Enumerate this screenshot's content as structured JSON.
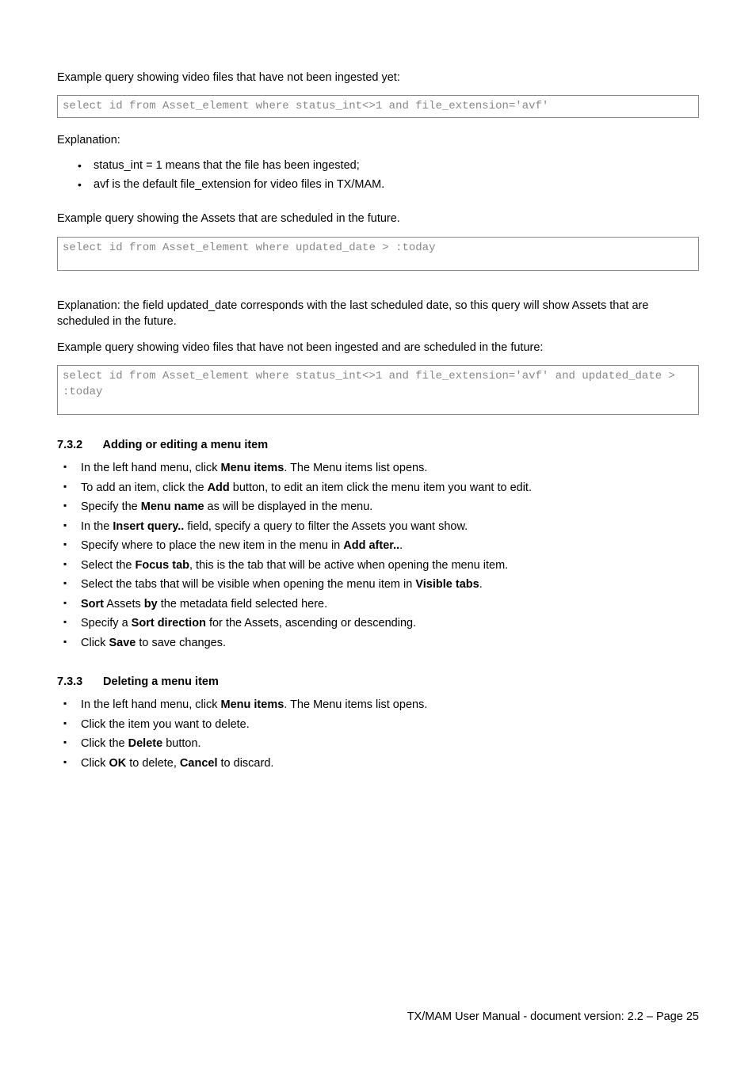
{
  "p1": "Example query showing video files that have not been ingested yet:",
  "code1": "select id from Asset_element where status_int<>1 and file_extension='avf'",
  "p2": "Explanation:",
  "circle_list": [
    "status_int = 1 means that the file has been ingested;",
    "avf is the default file_extension for video files in TX/MAM."
  ],
  "p3": "Example query showing the Assets that are scheduled in the future.",
  "code2": "select id from Asset_element where updated_date > :today",
  "p4": "Explanation: the field updated_date corresponds with the last scheduled date, so this query will show Assets that are scheduled in the future.",
  "p5": "Example query showing video files that have not been ingested and are scheduled in the future:",
  "code3": "select id from Asset_element where status_int<>1 and file_extension='avf' and updated_date > :today",
  "sec1": {
    "num": "7.3.2",
    "title": "Adding or editing a menu item"
  },
  "sec1_items": [
    [
      [
        "In the left hand menu, click "
      ],
      [
        "Menu items",
        "b"
      ],
      [
        ". The Menu items list opens."
      ]
    ],
    [
      [
        "To add an item, click the "
      ],
      [
        "Add",
        "b"
      ],
      [
        " button, to edit an item click the menu item you want to edit."
      ]
    ],
    [
      [
        "Specify the "
      ],
      [
        "Menu name",
        "b"
      ],
      [
        " as will be displayed in the menu."
      ]
    ],
    [
      [
        "In the "
      ],
      [
        "Insert query..",
        "b"
      ],
      [
        " field, specify a query to filter the Assets you want show."
      ]
    ],
    [
      [
        "Specify where to place the new item in the menu in "
      ],
      [
        "Add after..",
        "b"
      ],
      [
        "."
      ]
    ],
    [
      [
        "Select the "
      ],
      [
        "Focus tab",
        "b"
      ],
      [
        ", this is the tab that will be active when opening the menu item."
      ]
    ],
    [
      [
        "Select the tabs that will be visible when opening the menu item in "
      ],
      [
        "Visible tabs",
        "b"
      ],
      [
        "."
      ]
    ],
    [
      [
        "Sort",
        "b"
      ],
      [
        " Assets "
      ],
      [
        "by",
        "b"
      ],
      [
        " the metadata field selected here."
      ]
    ],
    [
      [
        "Specify a "
      ],
      [
        "Sort direction",
        "b"
      ],
      [
        " for the Assets, ascending or descending."
      ]
    ],
    [
      [
        "Click "
      ],
      [
        "Save",
        "b"
      ],
      [
        " to save changes."
      ]
    ]
  ],
  "sec2": {
    "num": "7.3.3",
    "title": "Deleting a menu item"
  },
  "sec2_items": [
    [
      [
        "In the left hand menu, click "
      ],
      [
        "Menu items",
        "b"
      ],
      [
        ". The Menu items list opens."
      ]
    ],
    [
      [
        "Click the item you want to delete."
      ]
    ],
    [
      [
        "Click the "
      ],
      [
        "Delete",
        "b"
      ],
      [
        " button."
      ]
    ],
    [
      [
        "Click "
      ],
      [
        "OK",
        "b"
      ],
      [
        " to delete, "
      ],
      [
        "Cancel",
        "b"
      ],
      [
        " to discard."
      ]
    ]
  ],
  "footer": "TX/MAM User Manual - document version: 2.2 – Page 25"
}
